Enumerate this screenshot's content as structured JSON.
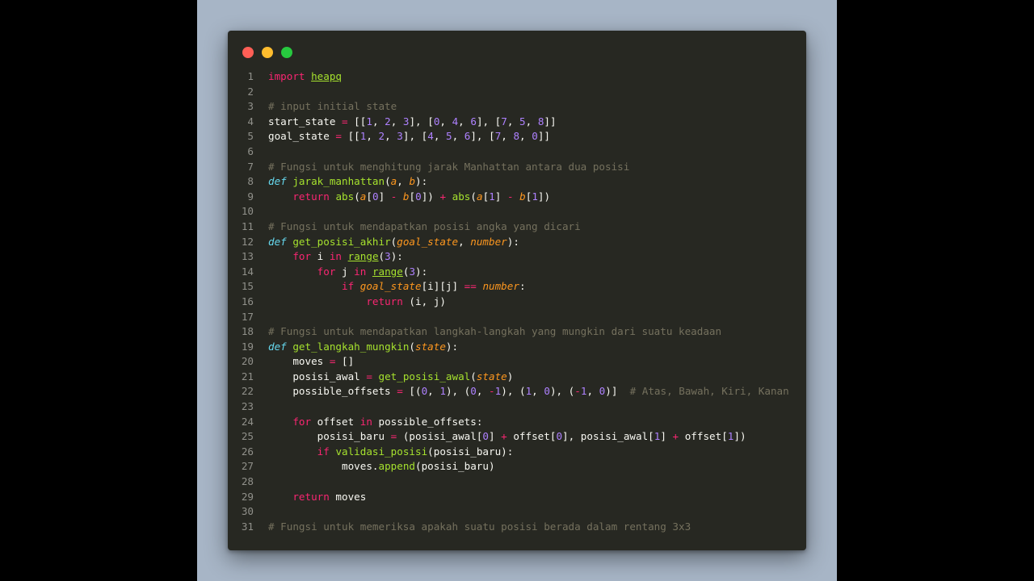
{
  "theme": {
    "background": "#a7b5c6",
    "editor_bg": "#272822",
    "dot_colors": [
      "#ff5f56",
      "#ffbd2e",
      "#27c93f"
    ],
    "token_colors": {
      "kw": "#f92672",
      "def": "#66d9ef",
      "fn": "#a6e22e",
      "fnu": "#a6e22e",
      "num": "#ae81ff",
      "op": "#f92672",
      "cm": "#75715e",
      "param": "#fd971f",
      "plain": "#f8f8f2"
    }
  },
  "window_controls": [
    {
      "name": "close-dot",
      "color": "#ff5f56"
    },
    {
      "name": "minimize-dot",
      "color": "#ffbd2e"
    },
    {
      "name": "maximize-dot",
      "color": "#27c93f"
    }
  ],
  "code_lines": [
    {
      "n": "1",
      "tokens": [
        [
          "kw",
          "import"
        ],
        [
          "plain",
          " "
        ],
        [
          "fnu",
          "heapq"
        ]
      ]
    },
    {
      "n": "2",
      "tokens": []
    },
    {
      "n": "3",
      "tokens": [
        [
          "cm",
          "# input initial state"
        ]
      ]
    },
    {
      "n": "4",
      "tokens": [
        [
          "plain",
          "start_state "
        ],
        [
          "op",
          "="
        ],
        [
          "plain",
          " [["
        ],
        [
          "num",
          "1"
        ],
        [
          "plain",
          ", "
        ],
        [
          "num",
          "2"
        ],
        [
          "plain",
          ", "
        ],
        [
          "num",
          "3"
        ],
        [
          "plain",
          "], ["
        ],
        [
          "num",
          "0"
        ],
        [
          "plain",
          ", "
        ],
        [
          "num",
          "4"
        ],
        [
          "plain",
          ", "
        ],
        [
          "num",
          "6"
        ],
        [
          "plain",
          "], ["
        ],
        [
          "num",
          "7"
        ],
        [
          "plain",
          ", "
        ],
        [
          "num",
          "5"
        ],
        [
          "plain",
          ", "
        ],
        [
          "num",
          "8"
        ],
        [
          "plain",
          "]]"
        ]
      ]
    },
    {
      "n": "5",
      "tokens": [
        [
          "plain",
          "goal_state "
        ],
        [
          "op",
          "="
        ],
        [
          "plain",
          " [["
        ],
        [
          "num",
          "1"
        ],
        [
          "plain",
          ", "
        ],
        [
          "num",
          "2"
        ],
        [
          "plain",
          ", "
        ],
        [
          "num",
          "3"
        ],
        [
          "plain",
          "], ["
        ],
        [
          "num",
          "4"
        ],
        [
          "plain",
          ", "
        ],
        [
          "num",
          "5"
        ],
        [
          "plain",
          ", "
        ],
        [
          "num",
          "6"
        ],
        [
          "plain",
          "], ["
        ],
        [
          "num",
          "7"
        ],
        [
          "plain",
          ", "
        ],
        [
          "num",
          "8"
        ],
        [
          "plain",
          ", "
        ],
        [
          "num",
          "0"
        ],
        [
          "plain",
          "]]"
        ]
      ]
    },
    {
      "n": "6",
      "tokens": []
    },
    {
      "n": "7",
      "tokens": [
        [
          "cm",
          "# Fungsi untuk menghitung jarak Manhattan antara dua posisi"
        ]
      ]
    },
    {
      "n": "8",
      "tokens": [
        [
          "def",
          "def"
        ],
        [
          "plain",
          " "
        ],
        [
          "fn",
          "jarak_manhattan"
        ],
        [
          "plain",
          "("
        ],
        [
          "param",
          "a"
        ],
        [
          "plain",
          ", "
        ],
        [
          "param",
          "b"
        ],
        [
          "plain",
          "):"
        ]
      ]
    },
    {
      "n": "9",
      "tokens": [
        [
          "plain",
          "    "
        ],
        [
          "kw",
          "return"
        ],
        [
          "plain",
          " "
        ],
        [
          "fn",
          "abs"
        ],
        [
          "plain",
          "("
        ],
        [
          "param",
          "a"
        ],
        [
          "plain",
          "["
        ],
        [
          "num",
          "0"
        ],
        [
          "plain",
          "] "
        ],
        [
          "op",
          "-"
        ],
        [
          "plain",
          " "
        ],
        [
          "param",
          "b"
        ],
        [
          "plain",
          "["
        ],
        [
          "num",
          "0"
        ],
        [
          "plain",
          "]) "
        ],
        [
          "op",
          "+"
        ],
        [
          "plain",
          " "
        ],
        [
          "fn",
          "abs"
        ],
        [
          "plain",
          "("
        ],
        [
          "param",
          "a"
        ],
        [
          "plain",
          "["
        ],
        [
          "num",
          "1"
        ],
        [
          "plain",
          "] "
        ],
        [
          "op",
          "-"
        ],
        [
          "plain",
          " "
        ],
        [
          "param",
          "b"
        ],
        [
          "plain",
          "["
        ],
        [
          "num",
          "1"
        ],
        [
          "plain",
          "])"
        ]
      ]
    },
    {
      "n": "10",
      "tokens": []
    },
    {
      "n": "11",
      "tokens": [
        [
          "cm",
          "# Fungsi untuk mendapatkan posisi angka yang dicari"
        ]
      ]
    },
    {
      "n": "12",
      "tokens": [
        [
          "def",
          "def"
        ],
        [
          "plain",
          " "
        ],
        [
          "fn",
          "get_posisi_akhir"
        ],
        [
          "plain",
          "("
        ],
        [
          "param",
          "goal_state"
        ],
        [
          "plain",
          ", "
        ],
        [
          "param",
          "number"
        ],
        [
          "plain",
          "):"
        ]
      ]
    },
    {
      "n": "13",
      "tokens": [
        [
          "plain",
          "    "
        ],
        [
          "kw",
          "for"
        ],
        [
          "plain",
          " i "
        ],
        [
          "kw",
          "in"
        ],
        [
          "plain",
          " "
        ],
        [
          "fnu",
          "range"
        ],
        [
          "plain",
          "("
        ],
        [
          "num",
          "3"
        ],
        [
          "plain",
          "):"
        ]
      ]
    },
    {
      "n": "14",
      "tokens": [
        [
          "plain",
          "        "
        ],
        [
          "kw",
          "for"
        ],
        [
          "plain",
          " j "
        ],
        [
          "kw",
          "in"
        ],
        [
          "plain",
          " "
        ],
        [
          "fnu",
          "range"
        ],
        [
          "plain",
          "("
        ],
        [
          "num",
          "3"
        ],
        [
          "plain",
          "):"
        ]
      ]
    },
    {
      "n": "15",
      "tokens": [
        [
          "plain",
          "            "
        ],
        [
          "kw",
          "if"
        ],
        [
          "plain",
          " "
        ],
        [
          "param",
          "goal_state"
        ],
        [
          "plain",
          "[i][j] "
        ],
        [
          "op",
          "=="
        ],
        [
          "plain",
          " "
        ],
        [
          "param",
          "number"
        ],
        [
          "plain",
          ":"
        ]
      ]
    },
    {
      "n": "16",
      "tokens": [
        [
          "plain",
          "                "
        ],
        [
          "kw",
          "return"
        ],
        [
          "plain",
          " (i, j)"
        ]
      ]
    },
    {
      "n": "17",
      "tokens": []
    },
    {
      "n": "18",
      "tokens": [
        [
          "cm",
          "# Fungsi untuk mendapatkan langkah-langkah yang mungkin dari suatu keadaan"
        ]
      ]
    },
    {
      "n": "19",
      "tokens": [
        [
          "def",
          "def"
        ],
        [
          "plain",
          " "
        ],
        [
          "fn",
          "get_langkah_mungkin"
        ],
        [
          "plain",
          "("
        ],
        [
          "param",
          "state"
        ],
        [
          "plain",
          "):"
        ]
      ]
    },
    {
      "n": "20",
      "tokens": [
        [
          "plain",
          "    moves "
        ],
        [
          "op",
          "="
        ],
        [
          "plain",
          " []"
        ]
      ]
    },
    {
      "n": "21",
      "tokens": [
        [
          "plain",
          "    posisi_awal "
        ],
        [
          "op",
          "="
        ],
        [
          "plain",
          " "
        ],
        [
          "fn",
          "get_posisi_awal"
        ],
        [
          "plain",
          "("
        ],
        [
          "param",
          "state"
        ],
        [
          "plain",
          ")"
        ]
      ]
    },
    {
      "n": "22",
      "tokens": [
        [
          "plain",
          "    possible_offsets "
        ],
        [
          "op",
          "="
        ],
        [
          "plain",
          " [("
        ],
        [
          "num",
          "0"
        ],
        [
          "plain",
          ", "
        ],
        [
          "num",
          "1"
        ],
        [
          "plain",
          "), ("
        ],
        [
          "num",
          "0"
        ],
        [
          "plain",
          ", "
        ],
        [
          "op",
          "-"
        ],
        [
          "num",
          "1"
        ],
        [
          "plain",
          "), ("
        ],
        [
          "num",
          "1"
        ],
        [
          "plain",
          ", "
        ],
        [
          "num",
          "0"
        ],
        [
          "plain",
          "), ("
        ],
        [
          "op",
          "-"
        ],
        [
          "num",
          "1"
        ],
        [
          "plain",
          ", "
        ],
        [
          "num",
          "0"
        ],
        [
          "plain",
          ")]  "
        ],
        [
          "cm",
          "# Atas, Bawah, Kiri, Kanan"
        ]
      ]
    },
    {
      "n": "23",
      "tokens": []
    },
    {
      "n": "24",
      "tokens": [
        [
          "plain",
          "    "
        ],
        [
          "kw",
          "for"
        ],
        [
          "plain",
          " offset "
        ],
        [
          "kw",
          "in"
        ],
        [
          "plain",
          " possible_offsets:"
        ]
      ]
    },
    {
      "n": "25",
      "tokens": [
        [
          "plain",
          "        posisi_baru "
        ],
        [
          "op",
          "="
        ],
        [
          "plain",
          " (posisi_awal["
        ],
        [
          "num",
          "0"
        ],
        [
          "plain",
          "] "
        ],
        [
          "op",
          "+"
        ],
        [
          "plain",
          " offset["
        ],
        [
          "num",
          "0"
        ],
        [
          "plain",
          "], posisi_awal["
        ],
        [
          "num",
          "1"
        ],
        [
          "plain",
          "] "
        ],
        [
          "op",
          "+"
        ],
        [
          "plain",
          " offset["
        ],
        [
          "num",
          "1"
        ],
        [
          "plain",
          "])"
        ]
      ]
    },
    {
      "n": "26",
      "tokens": [
        [
          "plain",
          "        "
        ],
        [
          "kw",
          "if"
        ],
        [
          "plain",
          " "
        ],
        [
          "fn",
          "validasi_posisi"
        ],
        [
          "plain",
          "(posisi_baru):"
        ]
      ]
    },
    {
      "n": "27",
      "tokens": [
        [
          "plain",
          "            moves."
        ],
        [
          "fn",
          "append"
        ],
        [
          "plain",
          "(posisi_baru)"
        ]
      ]
    },
    {
      "n": "28",
      "tokens": []
    },
    {
      "n": "29",
      "tokens": [
        [
          "plain",
          "    "
        ],
        [
          "kw",
          "return"
        ],
        [
          "plain",
          " moves"
        ]
      ]
    },
    {
      "n": "30",
      "tokens": []
    },
    {
      "n": "31",
      "tokens": [
        [
          "cm",
          "# Fungsi untuk memeriksa apakah suatu posisi berada dalam rentang 3x3"
        ]
      ]
    }
  ]
}
